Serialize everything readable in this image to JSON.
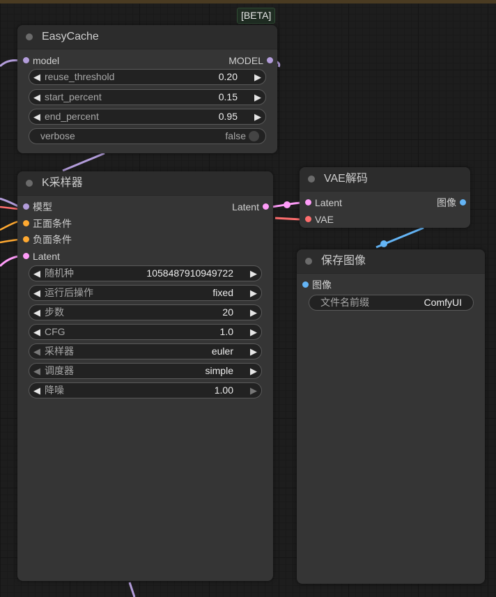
{
  "badge": "[BETA]",
  "easycache": {
    "title": "EasyCache",
    "input_model": "model",
    "output_model": "MODEL",
    "widgets": [
      {
        "label": "reuse_threshold",
        "value": "0.20"
      },
      {
        "label": "start_percent",
        "value": "0.15"
      },
      {
        "label": "end_percent",
        "value": "0.95"
      }
    ],
    "toggle": {
      "label": "verbose",
      "value": "false"
    }
  },
  "ksampler": {
    "title": "K采样器",
    "inputs": [
      "模型",
      "正面条件",
      "负面条件",
      "Latent"
    ],
    "output": "Latent",
    "widgets": [
      {
        "label": "随机种",
        "value": "1058487910949722"
      },
      {
        "label": "运行后操作",
        "value": "fixed"
      },
      {
        "label": "步数",
        "value": "20"
      },
      {
        "label": "CFG",
        "value": "1.0"
      },
      {
        "label": "采样器",
        "value": "euler"
      },
      {
        "label": "调度器",
        "value": "simple"
      },
      {
        "label": "降噪",
        "value": "1.00"
      }
    ]
  },
  "vae_decode": {
    "title": "VAE解码",
    "inputs": [
      "Latent",
      "VAE"
    ],
    "output": "图像"
  },
  "save_image": {
    "title": "保存图像",
    "input": "图像",
    "widget": {
      "label": "文件名前缀",
      "value": "ComfyUI"
    }
  },
  "colors": {
    "model": "#b39ddb",
    "conditioning": "#ffa931",
    "latent": "#ff9cf9",
    "vae": "#ff6e6e",
    "image": "#64b5f6",
    "node_bg": "#353535",
    "title_bg": "#2c2c2c"
  }
}
